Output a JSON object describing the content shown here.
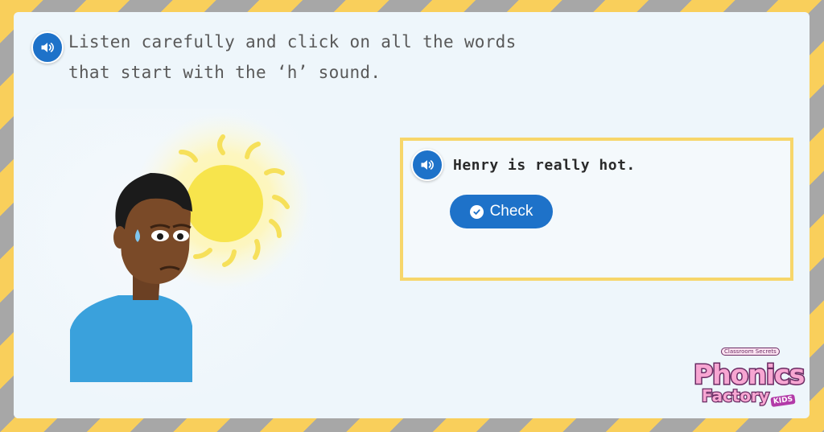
{
  "instruction": {
    "line1": "Listen carefully and click on all the words",
    "line2": "that start with the ‘h’ sound.",
    "speaker_icon": "speaker-icon"
  },
  "question": {
    "sentence": "Henry is really hot.",
    "speaker_icon": "speaker-icon",
    "check_label": "Check",
    "check_icon": "check-circle-icon"
  },
  "logo": {
    "word1": "Phonics",
    "word2": "Factory",
    "badge": "Classroom Secrets",
    "kids": "KIDS"
  },
  "colors": {
    "accent_blue": "#1e72c9",
    "box_border": "#f7d66a",
    "stripe_yellow": "#f9cf5b",
    "stripe_gray": "#a7a7a7",
    "logo_pink": "#f7a6d2",
    "logo_purple": "#6a2b63"
  }
}
